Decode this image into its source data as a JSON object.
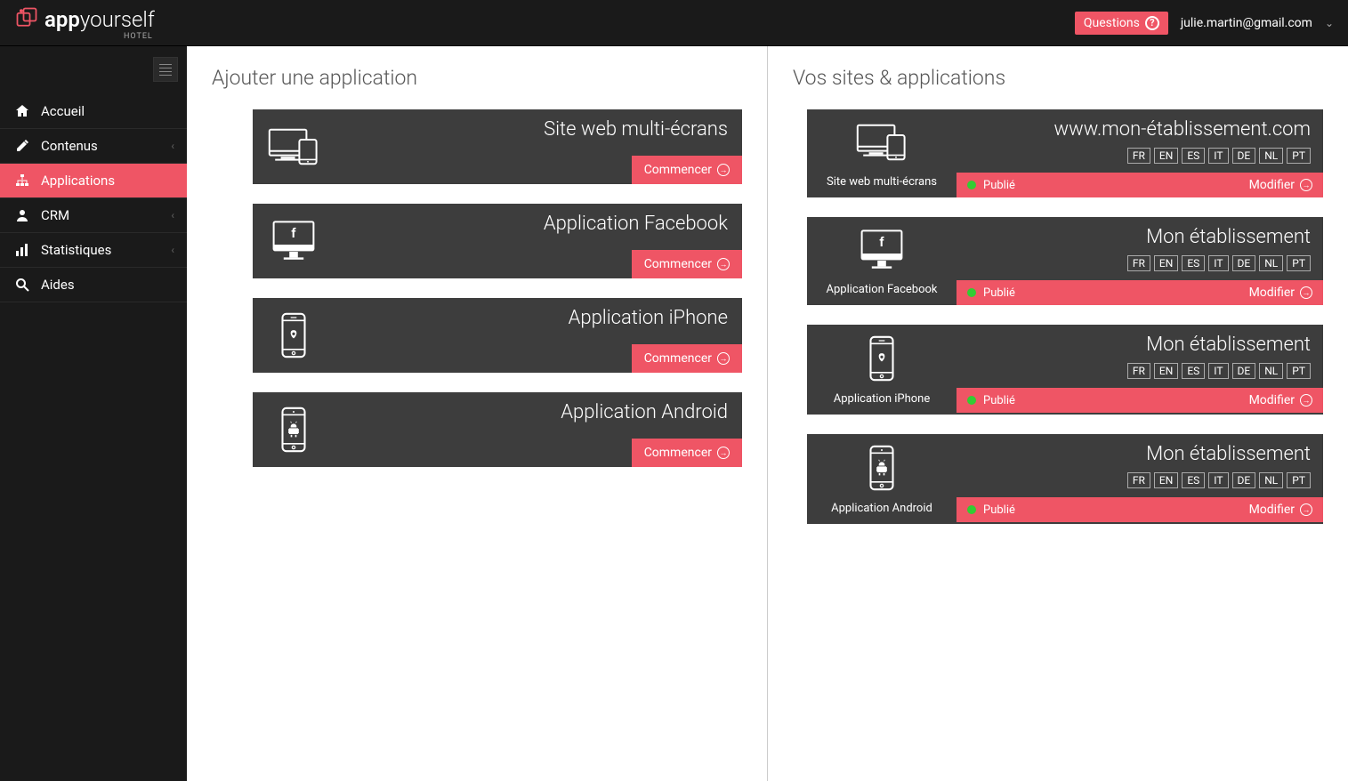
{
  "brand": {
    "bold": "app",
    "light": "yourself",
    "sub": "HOTEL"
  },
  "header": {
    "questions": "Questions",
    "email": "julie.martin@gmail.com"
  },
  "nav": [
    {
      "icon": "home",
      "label": "Accueil",
      "expandable": false,
      "active": false
    },
    {
      "icon": "edit",
      "label": "Contenus",
      "expandable": true,
      "active": false
    },
    {
      "icon": "sitemap",
      "label": "Applications",
      "expandable": false,
      "active": true
    },
    {
      "icon": "user",
      "label": "CRM",
      "expandable": true,
      "active": false
    },
    {
      "icon": "bars",
      "label": "Statistiques",
      "expandable": true,
      "active": false
    },
    {
      "icon": "search",
      "label": "Aides",
      "expandable": false,
      "active": false
    }
  ],
  "left_title": "Ajouter une application",
  "right_title": "Vos sites & applications",
  "commence": "Commencer",
  "modify": "Modifier",
  "languages": [
    "FR",
    "EN",
    "ES",
    "IT",
    "DE",
    "NL",
    "PT"
  ],
  "add_apps": [
    {
      "title": "Site web multi-écrans",
      "icon": "multi"
    },
    {
      "title": "Application Facebook",
      "icon": "facebook"
    },
    {
      "title": "Application iPhone",
      "icon": "iphone"
    },
    {
      "title": "Application Android",
      "icon": "android"
    }
  ],
  "sites": [
    {
      "title": "www.mon-établissement.com",
      "type": "Site web multi-écrans",
      "icon": "multi",
      "status": "Publié"
    },
    {
      "title": "Mon établissement",
      "type": "Application Facebook",
      "icon": "facebook",
      "status": "Publié"
    },
    {
      "title": "Mon établissement",
      "type": "Application iPhone",
      "icon": "iphone",
      "status": "Publié"
    },
    {
      "title": "Mon établissement",
      "type": "Application Android",
      "icon": "android",
      "status": "Publié"
    }
  ]
}
